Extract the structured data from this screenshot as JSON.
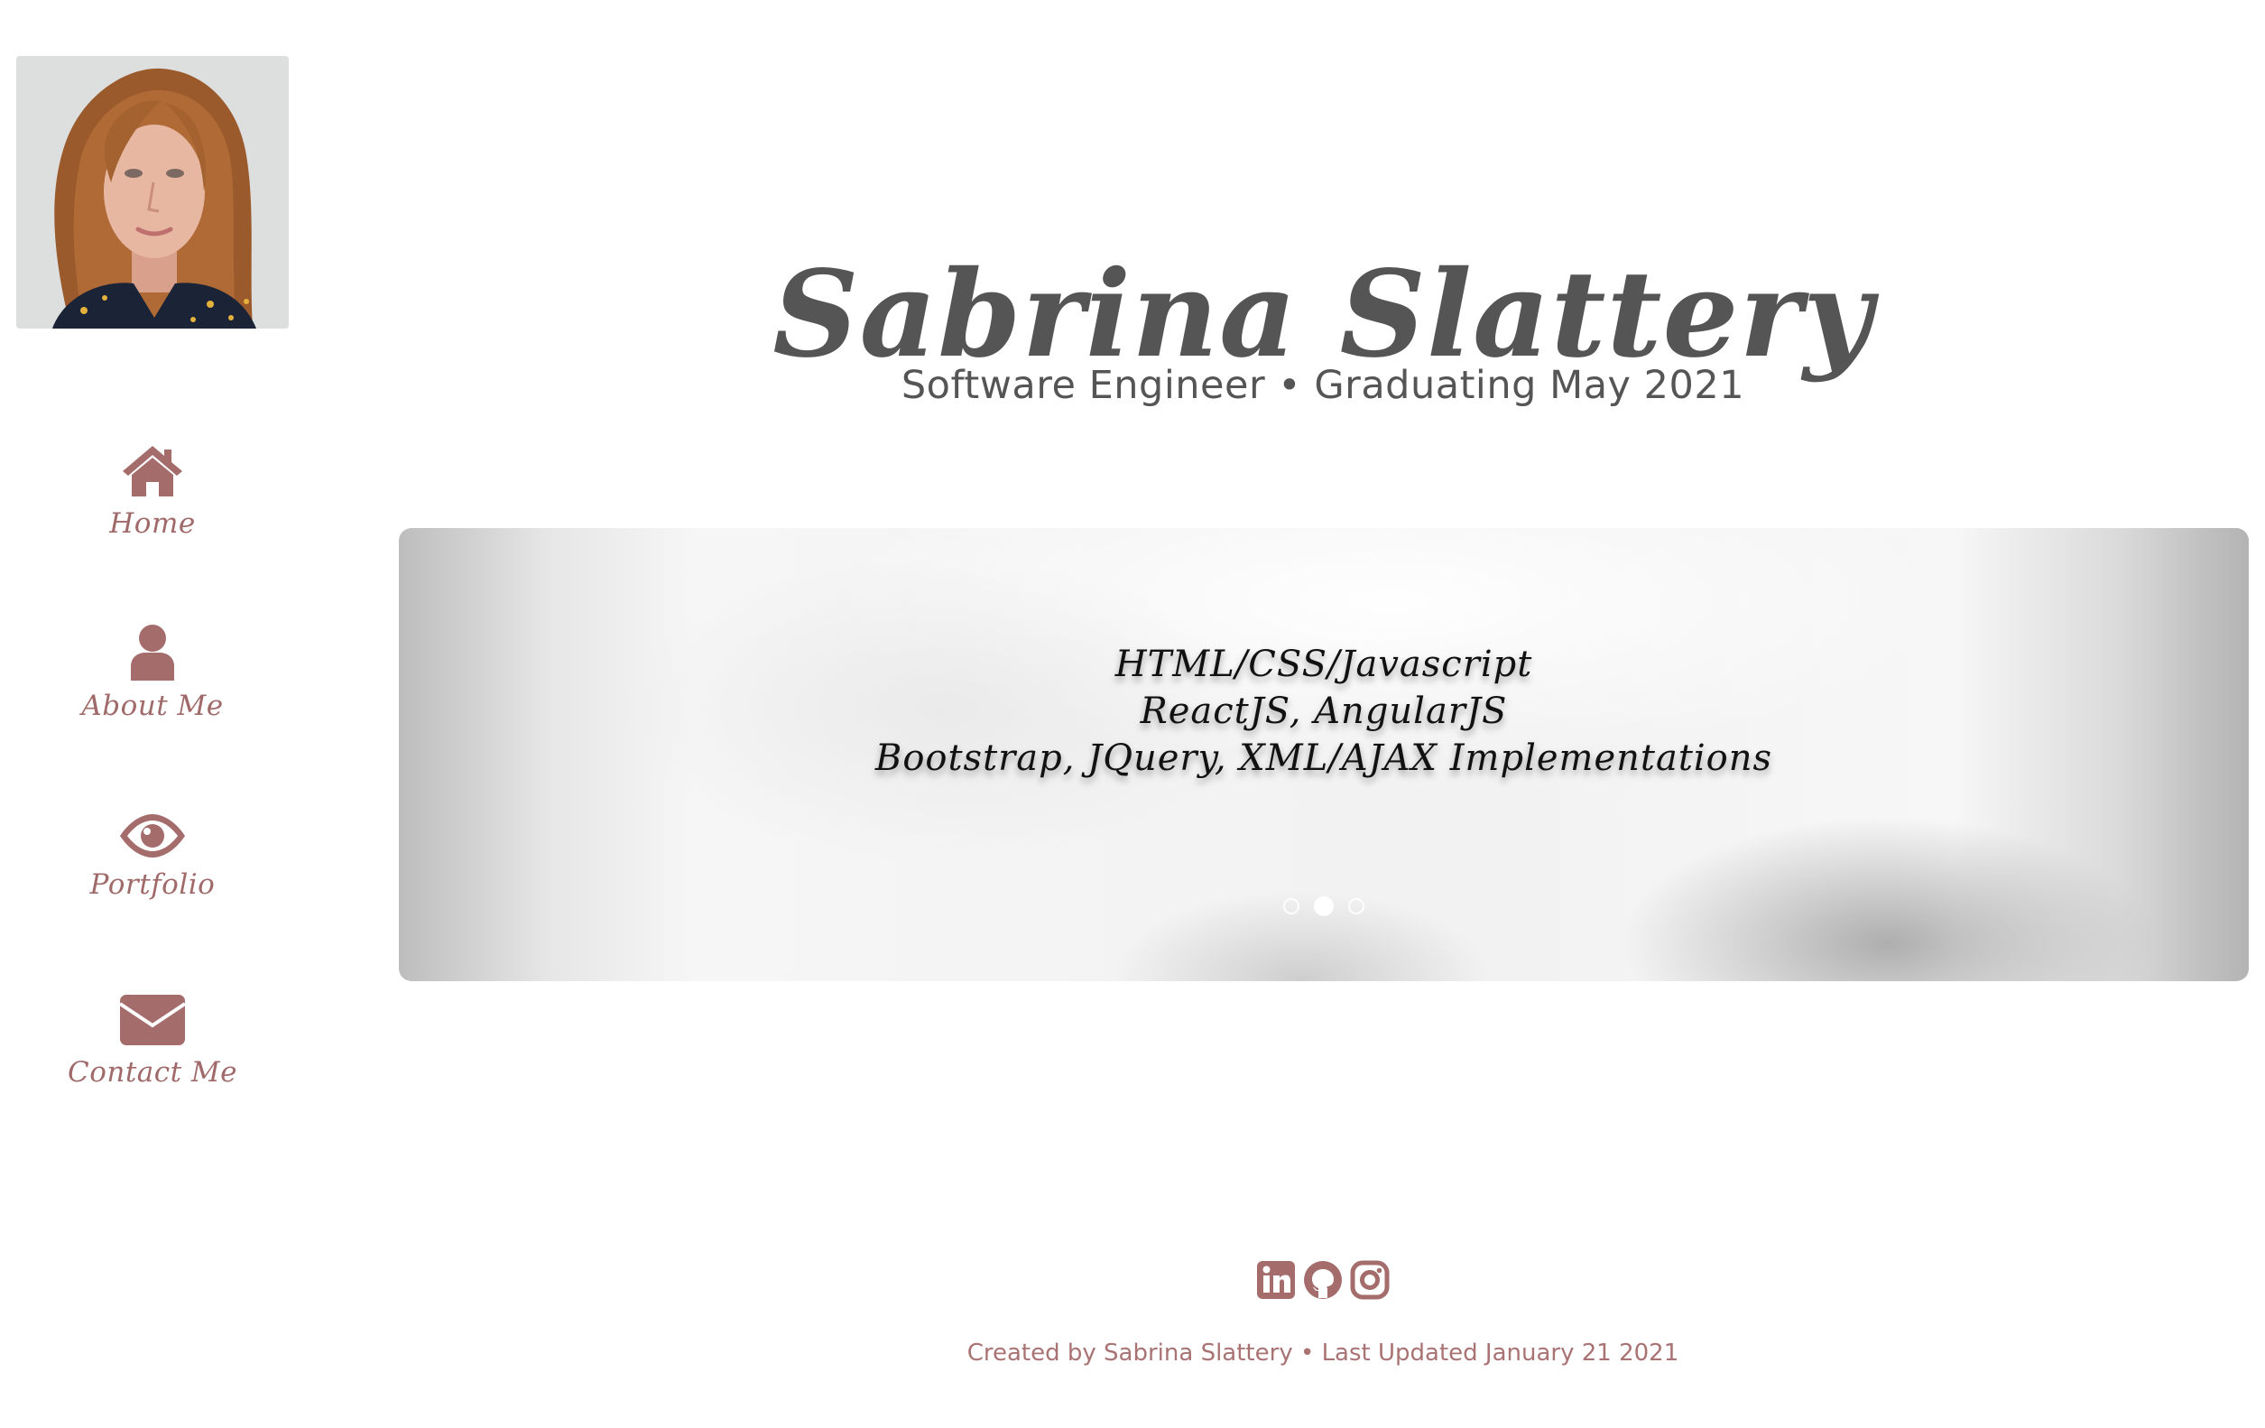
{
  "sidebar": {
    "avatar_alt": "Profile photo",
    "items": [
      {
        "label": "Home",
        "icon": "home-icon"
      },
      {
        "label": "About Me",
        "icon": "user-icon"
      },
      {
        "label": "Portfolio",
        "icon": "eye-icon"
      },
      {
        "label": "Contact Me",
        "icon": "envelope-icon"
      }
    ]
  },
  "header": {
    "title": "Sabrina Slattery",
    "subtitle": "Software Engineer • Graduating May 2021"
  },
  "carousel": {
    "lines": [
      "HTML/CSS/Javascript",
      "ReactJS, AngularJS",
      "Bootstrap, JQuery, XML/AJAX Implementations"
    ],
    "slide_count": 3,
    "active_slide": 2
  },
  "footer": {
    "social": [
      "linkedin-icon",
      "github-icon",
      "instagram-icon"
    ],
    "text": "Created by Sabrina Slattery • Last Updated January 21 2021"
  },
  "colors": {
    "accent": "#a56c6c",
    "title": "#555555",
    "footer_text": "#a97373"
  }
}
